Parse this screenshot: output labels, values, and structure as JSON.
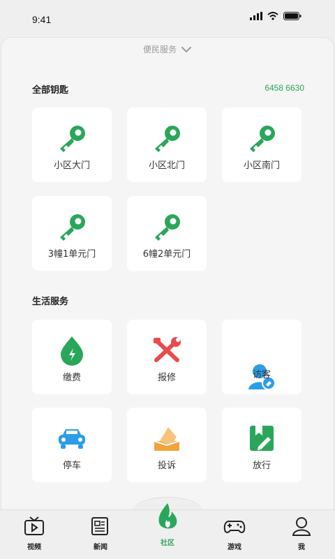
{
  "status": {
    "time": "9:41"
  },
  "sheet": {
    "header": "便民服务"
  },
  "keys": {
    "title": "全部钥匙",
    "phone": "6458 6630",
    "items": [
      {
        "label": "小区大门"
      },
      {
        "label": "小区北门"
      },
      {
        "label": "小区南门"
      },
      {
        "label": "3幢1单元门"
      },
      {
        "label": "6幢2单元门"
      }
    ]
  },
  "services": {
    "title": "生活服务",
    "items": [
      {
        "label": "缴费",
        "icon": "payment-drop-icon"
      },
      {
        "label": "报修",
        "icon": "repair-tools-icon"
      },
      {
        "label": "访客",
        "icon": "visitor-icon"
      },
      {
        "label": "停车",
        "icon": "car-icon"
      },
      {
        "label": "投诉",
        "icon": "complaint-icon"
      },
      {
        "label": "放行",
        "icon": "release-icon"
      }
    ]
  },
  "tabbar": {
    "items": [
      {
        "label": "视频"
      },
      {
        "label": "新闻"
      },
      {
        "label": "社区"
      },
      {
        "label": "游戏"
      },
      {
        "label": "我"
      }
    ],
    "active": "社区"
  },
  "colors": {
    "accent": "#2aa65a",
    "key": "#2aa65a",
    "repair": "#e94b4b",
    "car": "#2b9de8",
    "complaint": "#f2a33a"
  }
}
